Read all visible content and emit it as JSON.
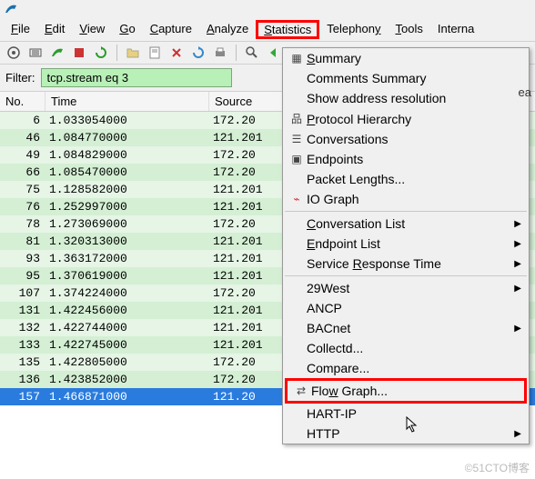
{
  "app": {
    "name": "Wireshark"
  },
  "menubar": {
    "file": "File",
    "edit": "Edit",
    "view": "View",
    "go": "Go",
    "capture": "Capture",
    "analyze": "Analyze",
    "statistics": "Statistics",
    "telephony": "Telephony",
    "tools": "Tools",
    "internals": "Interna"
  },
  "filter": {
    "label": "Filter:",
    "value": "tcp.stream eq 3"
  },
  "columns": {
    "no": "No.",
    "time": "Time",
    "source": "Source"
  },
  "packets": [
    {
      "no": "6",
      "time": "1.033054000",
      "src": "172.20"
    },
    {
      "no": "46",
      "time": "1.084770000",
      "src": "121.201"
    },
    {
      "no": "49",
      "time": "1.084829000",
      "src": "172.20"
    },
    {
      "no": "66",
      "time": "1.085470000",
      "src": "172.20"
    },
    {
      "no": "75",
      "time": "1.128582000",
      "src": "121.201"
    },
    {
      "no": "76",
      "time": "1.252997000",
      "src": "121.201"
    },
    {
      "no": "78",
      "time": "1.273069000",
      "src": "172.20"
    },
    {
      "no": "81",
      "time": "1.320313000",
      "src": "121.201"
    },
    {
      "no": "93",
      "time": "1.363172000",
      "src": "121.201"
    },
    {
      "no": "95",
      "time": "1.370619000",
      "src": "121.201"
    },
    {
      "no": "107",
      "time": "1.374224000",
      "src": "172.20"
    },
    {
      "no": "131",
      "time": "1.422456000",
      "src": "121.201"
    },
    {
      "no": "132",
      "time": "1.422744000",
      "src": "121.201"
    },
    {
      "no": "133",
      "time": "1.422745000",
      "src": "121.201"
    },
    {
      "no": "135",
      "time": "1.422805000",
      "src": "172.20"
    },
    {
      "no": "136",
      "time": "1.423852000",
      "src": "172.20"
    },
    {
      "no": "157",
      "time": "1.466871000",
      "src": "121.20"
    }
  ],
  "stats_menu": {
    "summary": "Summary",
    "comments_summary": "Comments Summary",
    "show_addr": "Show address resolution",
    "protocol_hierarchy": "Protocol Hierarchy",
    "conversations": "Conversations",
    "endpoints": "Endpoints",
    "packet_lengths": "Packet Lengths...",
    "io_graph": "IO Graph",
    "conversation_list": "Conversation List",
    "endpoint_list": "Endpoint List",
    "service_response": "Service Response Time",
    "twentynine_west": "29West",
    "ancp": "ANCP",
    "bacnet": "BACnet",
    "collectd": "Collectd...",
    "compare": "Compare...",
    "flow_graph": "Flow Graph...",
    "hart_ip": "HART-IP",
    "http": "HTTP"
  },
  "misc": {
    "ea_label": "ea",
    "watermark": "©51CTO博客"
  }
}
